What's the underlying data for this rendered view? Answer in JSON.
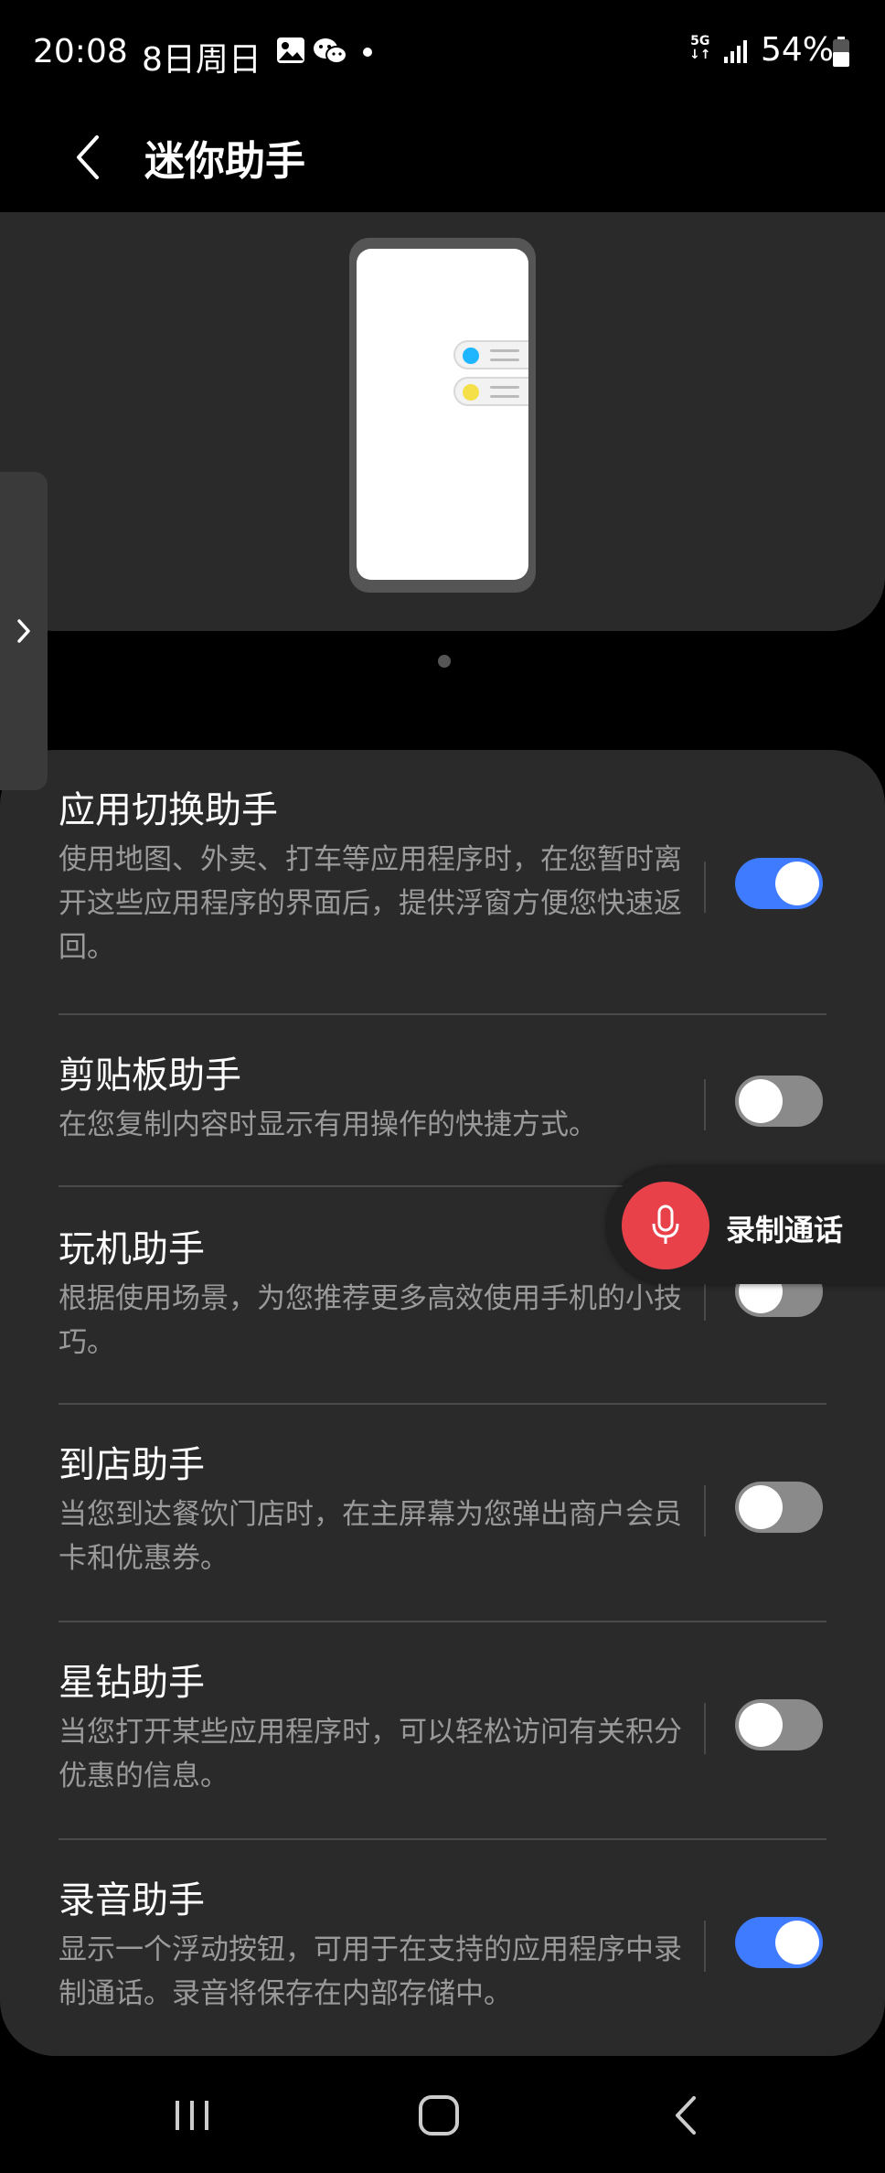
{
  "status_bar": {
    "time": "20:08",
    "date": "8日周日",
    "network": "5G",
    "battery_percent": "54%",
    "notification_icons": [
      "gallery-icon",
      "wechat-icon"
    ]
  },
  "header": {
    "title": "迷你助手"
  },
  "floating_button": {
    "label": "录制通话"
  },
  "settings": [
    {
      "title": "应用切换助手",
      "desc": "使用地图、外卖、打车等应用程序时，在您暂时离开这些应用程序的界面后，提供浮窗方便您快速返回。",
      "enabled": true
    },
    {
      "title": "剪贴板助手",
      "desc": "在您复制内容时显示有用操作的快捷方式。",
      "enabled": false
    },
    {
      "title": "玩机助手",
      "desc": "根据使用场景，为您推荐更多高效使用手机的小技巧。",
      "enabled": false
    },
    {
      "title": "到店助手",
      "desc": "当您到达餐饮门店时，在主屏幕为您弹出商户会员卡和优惠券。",
      "enabled": false
    },
    {
      "title": "星钻助手",
      "desc": "当您打开某些应用程序时，可以轻松访问有关积分优惠的信息。",
      "enabled": false
    },
    {
      "title": "录音助手",
      "desc": "显示一个浮动按钮，可用于在支持的应用程序中录制通话。录音将保存在内部存储中。",
      "enabled": true
    }
  ],
  "colors": {
    "toggle_on": "#3e7bff",
    "toggle_off": "#8a8a8a",
    "record_button": "#e8414a",
    "card_background": "#2a2a2a",
    "bubble_blue": "#1fb6ff",
    "bubble_yellow": "#f5e04a"
  }
}
